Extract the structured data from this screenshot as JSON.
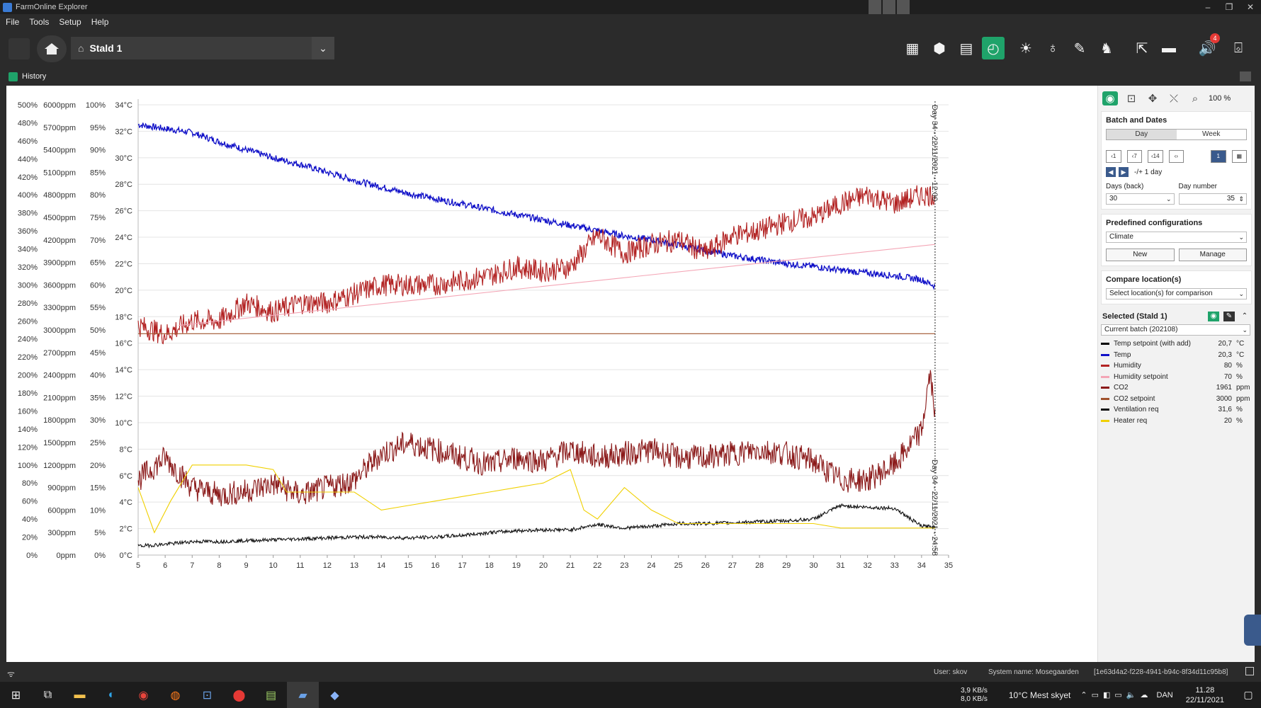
{
  "window": {
    "title": "FarmOnline Explorer",
    "controls": [
      "–",
      "❐",
      "✕"
    ]
  },
  "menu": [
    "File",
    "Tools",
    "Setup",
    "Help"
  ],
  "toolbar": {
    "location": "Stald 1",
    "alarm_count": "4"
  },
  "history": {
    "label": "History"
  },
  "chart_data": {
    "type": "line",
    "x": {
      "label": "",
      "range": [
        5,
        35
      ],
      "ticks": [
        5,
        6,
        7,
        8,
        9,
        10,
        11,
        12,
        13,
        14,
        15,
        16,
        17,
        18,
        19,
        20,
        21,
        22,
        23,
        24,
        25,
        26,
        27,
        28,
        29,
        30,
        31,
        32,
        33,
        34,
        35
      ]
    },
    "axes": [
      {
        "id": "pct_big",
        "range": [
          0,
          500
        ],
        "ticks": [
          "0%",
          "20%",
          "40%",
          "60%",
          "80%",
          "100%",
          "120%",
          "140%",
          "160%",
          "180%",
          "200%",
          "220%",
          "240%",
          "260%",
          "280%",
          "300%",
          "320%",
          "340%",
          "360%",
          "380%",
          "400%",
          "420%",
          "440%",
          "460%",
          "480%",
          "500%"
        ]
      },
      {
        "id": "ppm",
        "range": [
          0,
          6000
        ],
        "ticks": [
          "0ppm",
          "300ppm",
          "600ppm",
          "900ppm",
          "1200ppm",
          "1500ppm",
          "1800ppm",
          "2100ppm",
          "2400ppm",
          "2700ppm",
          "3000ppm",
          "3300ppm",
          "3600ppm",
          "3900ppm",
          "4200ppm",
          "4500ppm",
          "4800ppm",
          "5100ppm",
          "5400ppm",
          "5700ppm",
          "6000ppm"
        ]
      },
      {
        "id": "pct",
        "range": [
          0,
          100
        ],
        "ticks": [
          "0%",
          "5%",
          "10%",
          "15%",
          "20%",
          "25%",
          "30%",
          "35%",
          "40%",
          "45%",
          "50%",
          "55%",
          "60%",
          "65%",
          "70%",
          "75%",
          "80%",
          "85%",
          "90%",
          "95%",
          "100%"
        ]
      },
      {
        "id": "temp",
        "range": [
          0,
          34
        ],
        "ticks": [
          "0°C",
          "2°C",
          "4°C",
          "6°C",
          "8°C",
          "10°C",
          "12°C",
          "14°C",
          "16°C",
          "18°C",
          "20°C",
          "22°C",
          "24°C",
          "26°C",
          "28°C",
          "30°C",
          "32°C",
          "34°C"
        ]
      }
    ],
    "marker": {
      "x": 34.5,
      "label_top": "Day 34 - 22/11/2021 - 12:00",
      "label_bottom": "Day 34 - 22/11/2021 - 24:58"
    },
    "series": [
      {
        "name": "Temp",
        "color": "#1010c8",
        "axis": "temp",
        "x": [
          5,
          6,
          7,
          8,
          9,
          10,
          11,
          12,
          13,
          14,
          15,
          16,
          17,
          18,
          19,
          20,
          21,
          22,
          23,
          24,
          25,
          26,
          27,
          28,
          29,
          30,
          31,
          32,
          33,
          34,
          34.5
        ],
        "y": [
          32.5,
          32.2,
          31.9,
          31.2,
          30.6,
          30,
          29.5,
          28.9,
          28.3,
          27.8,
          27.3,
          26.9,
          26.5,
          26.1,
          25.7,
          25.3,
          24.9,
          24.5,
          24.1,
          23.8,
          23.4,
          23,
          22.6,
          22.3,
          22,
          21.8,
          21.5,
          21.3,
          21.1,
          20.8,
          20.3
        ]
      },
      {
        "name": "Humidity",
        "color": "#b22222",
        "axis": "pct",
        "x": [
          5,
          6,
          7,
          8,
          9,
          10,
          11,
          12,
          13,
          14,
          15,
          16,
          17,
          18,
          19,
          20,
          21,
          22,
          23,
          24,
          25,
          26,
          27,
          28,
          29,
          30,
          31,
          32,
          33,
          34,
          34.5
        ],
        "y": [
          51,
          49,
          52,
          52,
          56,
          54,
          56,
          56,
          58,
          60,
          60,
          60,
          61,
          62,
          64,
          63,
          64,
          71,
          67,
          69,
          70,
          67,
          71,
          72,
          74,
          75,
          78,
          80,
          78,
          80,
          80
        ]
      },
      {
        "name": "Humidity setpoint",
        "color": "#f4a6b6",
        "axis": "pct",
        "x": [
          6.5,
          34.5
        ],
        "y": [
          51,
          69
        ]
      },
      {
        "name": "CO2",
        "color": "#8b1a1a",
        "axis": "ppm",
        "x": [
          5,
          6,
          7,
          8,
          9,
          10,
          11,
          12,
          13,
          14,
          15,
          16,
          17,
          18,
          19,
          20,
          21,
          22,
          23,
          24,
          25,
          26,
          27,
          28,
          29,
          30,
          31,
          32,
          33,
          34,
          34.3,
          34.5
        ],
        "y": [
          1000,
          1300,
          900,
          800,
          850,
          950,
          800,
          900,
          1000,
          1350,
          1500,
          1400,
          1300,
          1200,
          1300,
          1250,
          1400,
          1300,
          1350,
          1400,
          1300,
          1300,
          1350,
          1400,
          1350,
          1250,
          1000,
          1000,
          1200,
          1650,
          2400,
          1950
        ]
      },
      {
        "name": "CO2 setpoint",
        "color": "#a0522d",
        "axis": "ppm",
        "x": [
          5,
          34.5
        ],
        "y": [
          2950,
          2950
        ]
      },
      {
        "name": "Ventilation req",
        "color": "#111111",
        "axis": "pct_big",
        "x": [
          5,
          6,
          7,
          8,
          9,
          10,
          11,
          12,
          13,
          14,
          15,
          16,
          17,
          18,
          19,
          20,
          21,
          22,
          23,
          24,
          25,
          26,
          27,
          28,
          29,
          30,
          31,
          32,
          33,
          34,
          34.5
        ],
        "y": [
          10,
          12,
          15,
          15,
          16,
          17,
          18,
          19,
          20,
          20,
          19,
          20,
          22,
          25,
          27,
          28,
          28,
          34,
          30,
          32,
          35,
          35,
          36,
          37,
          38,
          40,
          55,
          53,
          52,
          32,
          31.6
        ]
      },
      {
        "name": "Heater req",
        "color": "#f0d000",
        "axis": "pct",
        "x": [
          5,
          5.6,
          6.2,
          7,
          8,
          9,
          10,
          10.5,
          11,
          12,
          13,
          14,
          15,
          16,
          17,
          18,
          19,
          20,
          21,
          21.5,
          22,
          23,
          24,
          25,
          26,
          27,
          28,
          29,
          30,
          31,
          32,
          33,
          34,
          34.5
        ],
        "y": [
          15,
          5,
          12,
          20,
          20,
          20,
          19,
          14,
          14,
          14,
          14,
          10,
          11,
          12,
          13,
          14,
          15,
          16,
          19,
          10,
          8,
          15,
          10,
          7,
          7,
          7,
          7,
          7,
          7,
          6,
          6,
          6,
          6,
          6
        ]
      }
    ]
  },
  "panel": {
    "zoom": "100 %",
    "batch_title": "Batch and Dates",
    "tab_day": "Day",
    "tab_week": "Week",
    "range_btns": [
      "‹1",
      "‹7",
      "‹14",
      "‹›"
    ],
    "step_label": "-/+ 1 day",
    "days_back_label": "Days (back)",
    "days_back_value": "30",
    "day_number_label": "Day number",
    "day_number_value": "35",
    "predef_title": "Predefined configurations",
    "predef_value": "Climate",
    "new_btn": "New",
    "manage_btn": "Manage",
    "compare_title": "Compare location(s)",
    "compare_placeholder": "Select location(s) for comparison",
    "selected_title": "Selected (Stald 1)",
    "batch_value": "Current batch (202108)",
    "legend": [
      {
        "name": "Temp setpoint (with add)",
        "value": "20,7",
        "unit": "°C",
        "color": "#000000"
      },
      {
        "name": "Temp",
        "value": "20,3",
        "unit": "°C",
        "color": "#1010c8"
      },
      {
        "name": "Humidity",
        "value": "80",
        "unit": "%",
        "color": "#b22222"
      },
      {
        "name": "Humidity setpoint",
        "value": "70",
        "unit": "%",
        "color": "#f4a6b6"
      },
      {
        "name": "CO2",
        "value": "1961",
        "unit": "ppm",
        "color": "#8b1a1a"
      },
      {
        "name": "CO2 setpoint",
        "value": "3000",
        "unit": "ppm",
        "color": "#a0522d"
      },
      {
        "name": "Ventilation req",
        "value": "31,6",
        "unit": "%",
        "color": "#111111"
      },
      {
        "name": "Heater req",
        "value": "20",
        "unit": "%",
        "color": "#f0d000"
      }
    ]
  },
  "status": {
    "user": "User: skov",
    "system": "System name: Mosegaarden",
    "guid": "[1e63d4a2-f228-4941-b94c-8f34d11c95b8]"
  },
  "taskbar": {
    "net_up": "3,9 KB/s",
    "net_down": "8,0 KB/s",
    "weather": "10°C  Mest skyet",
    "lang": "DAN",
    "time": "11.28",
    "date": "22/11/2021"
  }
}
